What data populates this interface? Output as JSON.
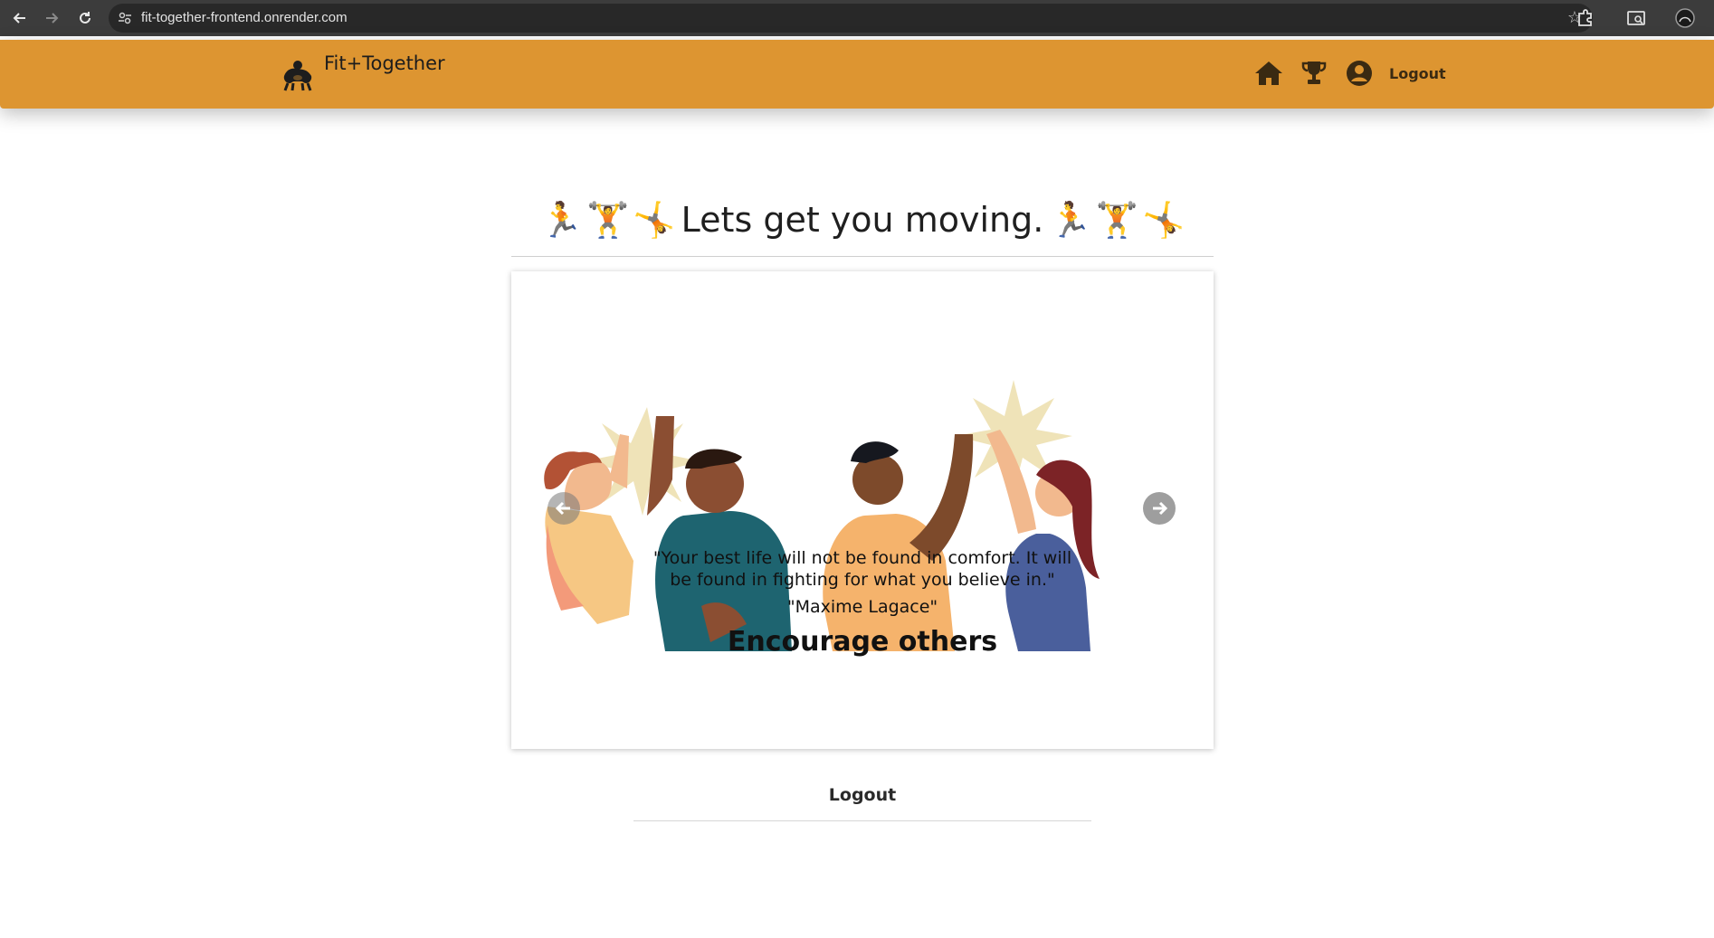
{
  "browser": {
    "url": "fit-together-frontend.onrender.com",
    "back_icon": "arrow-left",
    "forward_icon": "arrow-right",
    "reload_icon": "reload",
    "bookmark_icon": "star"
  },
  "header": {
    "brand_name": "Fit+Together",
    "nav": [
      {
        "icon": "home-icon"
      },
      {
        "icon": "trophy-icon"
      },
      {
        "icon": "user-circle-icon"
      }
    ],
    "logout_label": "Logout",
    "background_color": "#dd9531"
  },
  "hero": {
    "emojis_left": [
      "🏃",
      "🏋",
      "🤸"
    ],
    "title": "Lets get you moving.",
    "emojis_right": [
      "🏃",
      "🏋",
      "🤸"
    ]
  },
  "carousel": {
    "quote": "\"Your best life will not be found in comfort. It will be found in fighting for what you believe in.\"",
    "author": "\"Maxime Lagace\"",
    "caption": "Encourage others",
    "prev_icon": "arrow-left-circle",
    "next_icon": "arrow-right-circle"
  },
  "footer": {
    "logout_label": "Logout"
  }
}
